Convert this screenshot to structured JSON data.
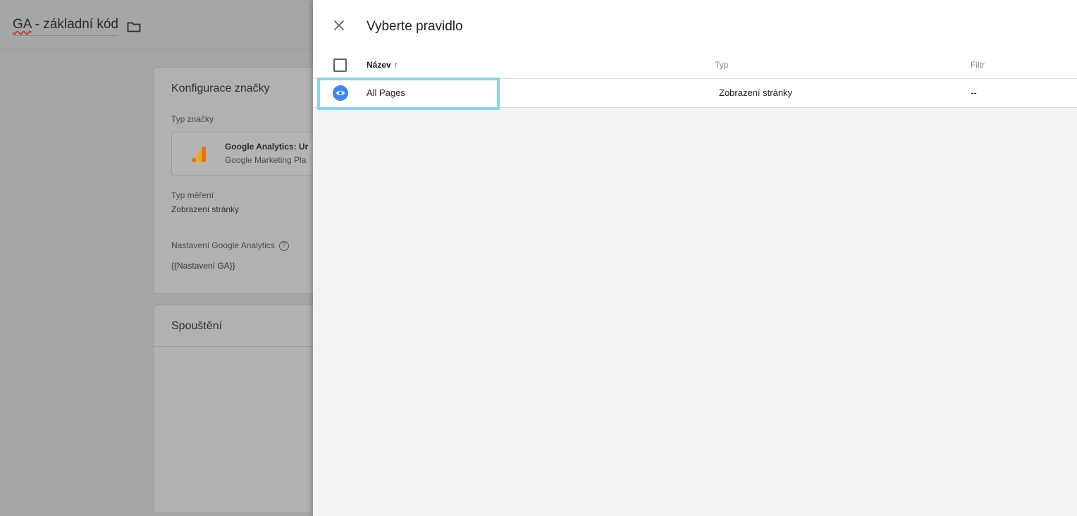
{
  "background": {
    "tag_title_prefix": "GA",
    "tag_title_rest": " - základní kód",
    "config_card": {
      "title": "Konfigurace značky",
      "tag_type_label": "Typ značky",
      "tag_type_name": "Google Analytics: Ur",
      "tag_type_sub": "Google Marketing Pla",
      "tracking_type_label": "Typ měření",
      "tracking_type_value": "Zobrazení stránky",
      "settings_label": "Nastavení Google Analytics",
      "settings_value": "{{Nastavení GA}}"
    },
    "trigger_card": {
      "title": "Spouštění"
    }
  },
  "panel": {
    "title": "Vyberte pravidlo",
    "columns": {
      "name": "Název",
      "sort_indicator": "↑",
      "type": "Typ",
      "filter": "Filtr"
    },
    "rows": [
      {
        "name": "All Pages",
        "type": "Zobrazení stránky",
        "filter": "--",
        "icon": "eye-icon"
      }
    ]
  },
  "colors": {
    "accent_blue": "#4285f4",
    "highlight": "#8fd2e6",
    "ga_orange": "#f9ab00",
    "ga_dark_orange": "#e37400"
  },
  "icons": {
    "close": "close-icon",
    "folder": "folder-icon",
    "help": "help-icon",
    "analytics": "google-analytics-icon"
  }
}
